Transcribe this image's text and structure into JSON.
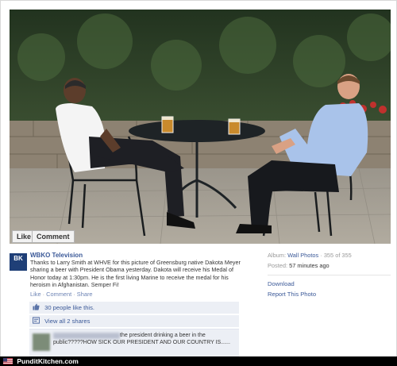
{
  "photo": {
    "like_label": "Like",
    "comment_label": "Comment"
  },
  "post": {
    "page_name": "WBKO Television",
    "thumb_text": "BK",
    "caption": "Thanks to Larry Smith at WHVE for this picture of Greensburg native Dakota Meyer sharing a beer with President Obama yesterday. Dakota will receive his Medal of Honor today at 1:30pm. He is the first living Marine to receive the medal for his heroism in Afghanistan. Semper Fi!",
    "actions": {
      "like": "Like",
      "comment": "Comment",
      "share": "Share",
      "separator": "·"
    },
    "likes_text": "30 people like this.",
    "shares_text": "View all 2 shares",
    "comment": {
      "text": "the president drinking a beer in the public?????HOW SICK OUR PRESIDENT AND OUR COUNTRY IS......"
    }
  },
  "sidebar": {
    "album_label": "Album:",
    "album_value": "Wall Photos",
    "album_count": "· 355 of 355",
    "posted_label": "Posted:",
    "posted_value": "57 minutes ago",
    "download": "Download",
    "report": "Report This Photo"
  },
  "footer": {
    "site": "PunditKitchen.com"
  },
  "colors": {
    "link_blue": "#3b5998",
    "action_bg": "#eceff5",
    "footer_bg": "#000000"
  }
}
